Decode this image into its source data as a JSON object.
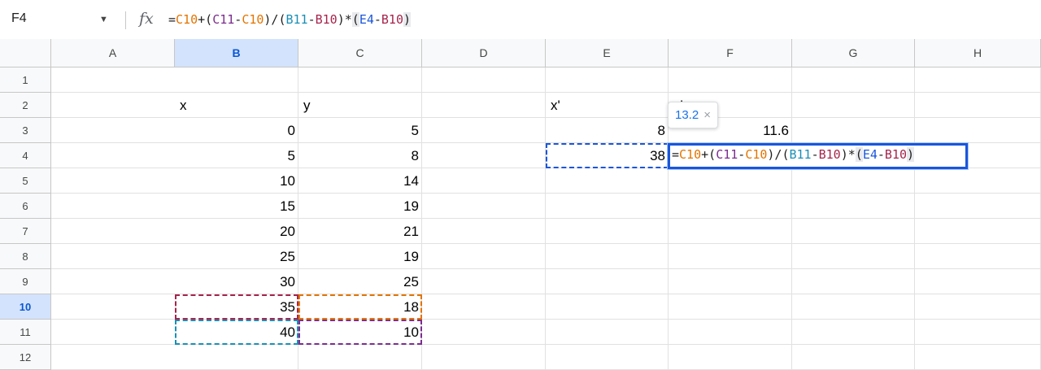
{
  "name_box": "F4",
  "formula": [
    {
      "text": "=",
      "color": "#1f1f1f"
    },
    {
      "text": "C10",
      "color": "#e37400"
    },
    {
      "text": "+(",
      "color": "#1f1f1f"
    },
    {
      "text": "C11",
      "color": "#7b2d8e"
    },
    {
      "text": "-",
      "color": "#1f1f1f"
    },
    {
      "text": "C10",
      "color": "#e37400"
    },
    {
      "text": ")/(",
      "color": "#1f1f1f"
    },
    {
      "text": "B11",
      "color": "#1a8fb5"
    },
    {
      "text": "-",
      "color": "#1f1f1f"
    },
    {
      "text": "B10",
      "color": "#a6244c"
    },
    {
      "text": ")*",
      "color": "#1f1f1f"
    },
    {
      "text": "(",
      "color": "#1f1f1f",
      "highlight": true
    },
    {
      "text": "E4",
      "color": "#1a56db"
    },
    {
      "text": "-",
      "color": "#1f1f1f"
    },
    {
      "text": "B10",
      "color": "#a6244c"
    },
    {
      "text": ")",
      "color": "#1f1f1f",
      "highlight": true
    }
  ],
  "columns": [
    "A",
    "B",
    "C",
    "D",
    "E",
    "F",
    "G",
    "H"
  ],
  "selected_column": "B",
  "rows": [
    "1",
    "2",
    "3",
    "4",
    "5",
    "6",
    "7",
    "8",
    "9",
    "10",
    "11",
    "12"
  ],
  "selected_row": "10",
  "cells": {
    "B2": "x",
    "C2": "y",
    "E2": "x'",
    "F2": "y'",
    "B3": "0",
    "C3": "5",
    "E3": "8",
    "F3": "11.6",
    "B4": "5",
    "C4": "8",
    "E4": "38",
    "B5": "10",
    "C5": "14",
    "B6": "15",
    "C6": "19",
    "B7": "20",
    "C7": "21",
    "B8": "25",
    "C8": "19",
    "B9": "30",
    "C9": "25",
    "B10": "35",
    "C10": "18",
    "B11": "40",
    "C11": "10"
  },
  "tooltip": {
    "value": "13.2",
    "close": "×"
  },
  "ref_colors": {
    "C10": "#e37400",
    "C11": "#7b2d8e",
    "B11": "#1a8fb5",
    "B10": "#a6244c",
    "E4": "#1a56db"
  }
}
